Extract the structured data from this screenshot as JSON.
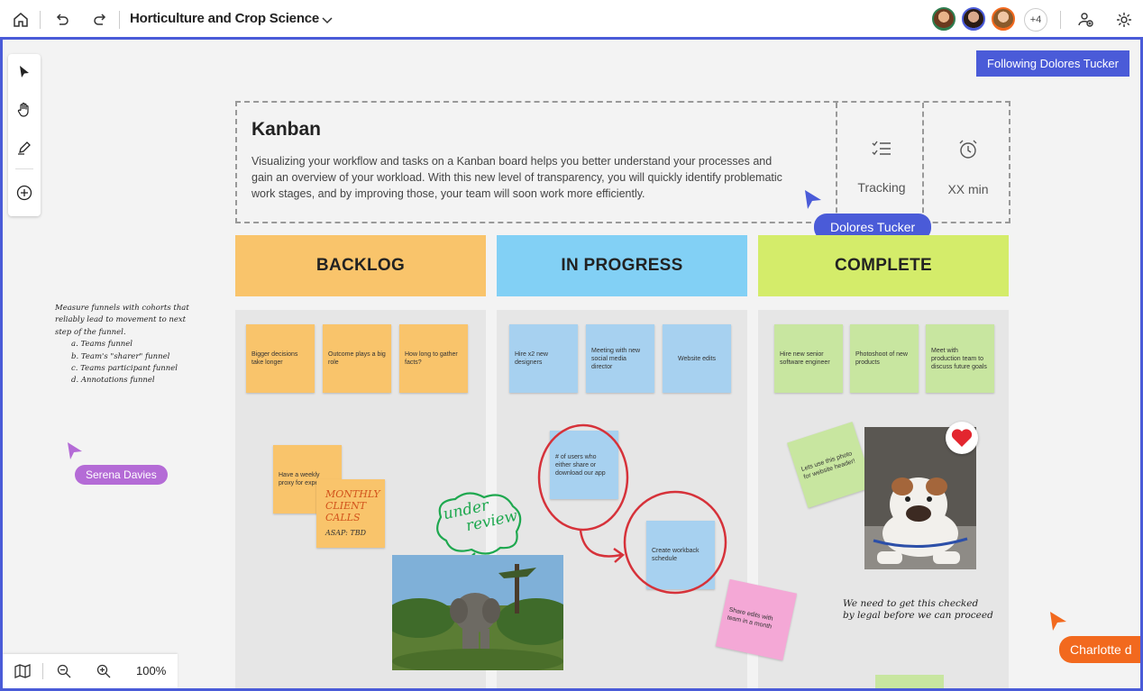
{
  "header": {
    "title": "Horticulture and Crop Science",
    "plus_count": "+4"
  },
  "follow_button": "Following Dolores Tucker",
  "kanban": {
    "title": "Kanban",
    "description": "Visualizing your workflow and tasks on a Kanban board helps you better understand your processes and gain an overview of your workload. With this new level of transparency, you will quickly identify problematic work stages, and by improving those, your team will soon work more efficiently.",
    "tracking_label": "Tracking",
    "time_label": "XX min"
  },
  "columns": [
    {
      "label": "BACKLOG",
      "color": "#f9c46b"
    },
    {
      "label": "IN PROGRESS",
      "color": "#82d0f5"
    },
    {
      "label": "COMPLETE",
      "color": "#d4ec6a"
    }
  ],
  "notes": {
    "backlog": [
      "Bigger decisions take longer",
      "Outcome plays a big role",
      "How long to gather facts?",
      "Have a weekly proxy for experiment"
    ],
    "progress": [
      "Hire x2 new designers",
      "Meeting with new social media director",
      "Website edits",
      "# of users who either share or download our app",
      "Create workback schedule"
    ],
    "complete": [
      "Hire new senior software engineer",
      "Photoshoot of new products",
      "Meet with production team to discuss future goals"
    ],
    "green_tilted": "Lets use this photo for website header!",
    "pink": "Share edits with team in a month"
  },
  "handwritten": {
    "side_note_lines": [
      "Measure funnels with cohorts that",
      "reliably lead to movement to next",
      "step of the funnel.",
      "a. Teams funnel",
      "b. Team's \"sharer\" funnel",
      "c. Teams participant funnel",
      "d. Annotations funnel"
    ],
    "monthly": [
      "MONTHLY",
      "CLIENT",
      "CALLS",
      "ASAP: TBD"
    ],
    "under_review": [
      "under",
      "review"
    ],
    "dog_caption": [
      "We need to get this checked",
      "by legal before we can proceed"
    ]
  },
  "collaborators": {
    "dolores": "Dolores Tucker",
    "serena": "Serena Davies",
    "charlotte": "Charlotte d"
  },
  "zoom": "100%",
  "colors": {
    "accent": "#4a5bd8",
    "serena": "#b46bd6",
    "charlotte": "#f2691e",
    "note_orange": "#f9c46b",
    "note_blue": "#a7d1f0",
    "note_green": "#c8e6a0",
    "note_pink": "#f4a8d6"
  }
}
